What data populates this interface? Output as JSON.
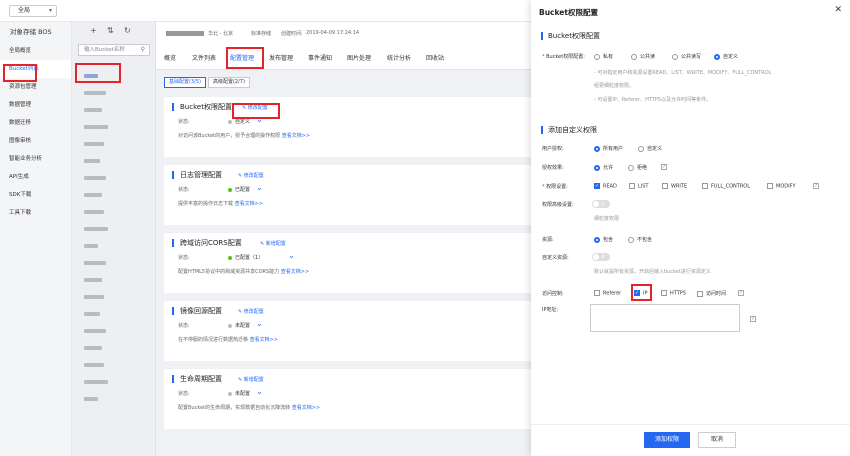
{
  "topbar": {
    "region": "全局"
  },
  "left_nav": {
    "title": "对象存储 BOS",
    "items": [
      "全局概览",
      "Bucket列表",
      "资源包管理",
      "数据管理",
      "数据迁移",
      "图像审核",
      "智能业务分析",
      "API生成",
      "SDK下载",
      "工具下载"
    ]
  },
  "bucket_panel": {
    "search_placeholder": "输入Bucket名称"
  },
  "main": {
    "header": {
      "region": "华北 - 北京",
      "storage": "标准存储",
      "created_label": "创建时间:",
      "created": "2019-04-09 17:24:14"
    },
    "tabs": [
      "概览",
      "文件列表",
      "配置管理",
      "发布管理",
      "事件通知",
      "图片处理",
      "统计分析",
      "回收站"
    ],
    "subtabs": [
      "基础配置(3/5)",
      "高级配置(2/7)"
    ],
    "cards": [
      {
        "title": "Bucket权限配置",
        "edit": "修改配置",
        "status_label": "状态:",
        "status": "自定义",
        "desc": "对访问该Bucket的用户，授予合理的操作权限",
        "link": "查看文档>>"
      },
      {
        "title": "日志管理配置",
        "edit": "修改配置",
        "status_label": "状态:",
        "status": "已配置",
        "desc": "提供丰富的操作日志下载",
        "link": "查看文档>>"
      },
      {
        "title": "跨域访问CORS配置",
        "edit": "新增配置",
        "status_label": "状态:",
        "status": "已配置（1）",
        "desc": "配置HTML5协议中的跨域资源共享CORS能力",
        "link": "查看文档>>"
      },
      {
        "title": "镜像回源配置",
        "edit": "修改配置",
        "status_label": "状态:",
        "status": "未配置",
        "desc": "在不停服的情况进行数据热迁移",
        "link": "查看文档>>"
      },
      {
        "title": "生命周期配置",
        "edit": "新增配置",
        "status_label": "状态:",
        "status": "未配置",
        "desc": "配置Bucket的生命周期，实现数据自动化沉降流转",
        "link": "查看文档>>"
      }
    ]
  },
  "modal": {
    "title": "Bucket权限配置",
    "section1": "Bucket权限配置",
    "perm_label": "Bucket权限配置:",
    "perm_options": [
      "私有",
      "公共读",
      "公共读写",
      "自定义"
    ],
    "help1": "- 可对指定用户和资源设置READ、LIST、WRITE、MODIFY、FULL_CONTROL",
    "help1b": "组更细粒度权限。",
    "help2": "- 可设置IP、Referer、HTTPS以及允许时间等条件。",
    "section2": "添加自定义权限",
    "user_label": "用户授权:",
    "user_options": [
      "所有用户",
      "自定义"
    ],
    "effect_label": "授权效果:",
    "effect_options": [
      "允许",
      "拒绝"
    ],
    "perms_label": "权限设置:",
    "perm_checks": [
      "READ",
      "LIST",
      "WRITE",
      "FULL_CONTROL",
      "MODIFY"
    ],
    "advanced_label": "权限高级设置:",
    "advanced_toggle": "关",
    "advanced_help": "细粒度权限",
    "resource_label": "资源:",
    "resource_options": [
      "包含",
      "不包含"
    ],
    "custom_res_label": "自定义资源:",
    "custom_res_toggle": "关",
    "custom_res_help": "默认就是所有资源，开启后输入bucket进行资源定义",
    "access_label": "访问控制:",
    "access_checks": [
      "Referer",
      "IP",
      "HTTPS",
      "访问时间"
    ],
    "ip_label": "IP地址:",
    "ok": "添加权限",
    "cancel": "取消",
    "help_q": "?"
  }
}
